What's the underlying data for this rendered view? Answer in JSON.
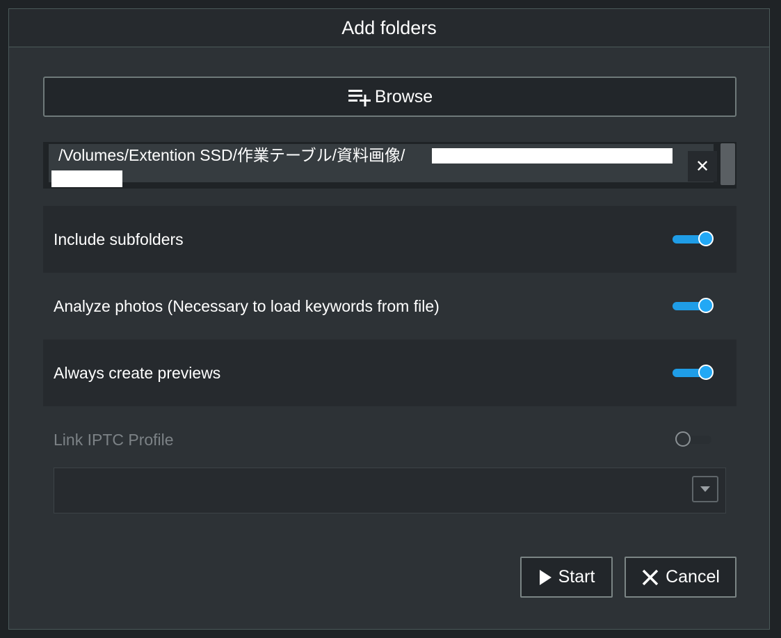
{
  "dialog": {
    "title": "Add folders"
  },
  "browse": {
    "label": "Browse",
    "icon": "playlist-add-icon"
  },
  "folders": [
    {
      "path": "/Volumes/Extention SSD/作業テーブル/資料画像/",
      "remove_icon": "close-icon",
      "remove_symbol": "✕"
    }
  ],
  "options": [
    {
      "label": "Include subfolders",
      "enabled": true,
      "disabled": false
    },
    {
      "label": "Analyze photos (Necessary to load keywords from file)",
      "enabled": true,
      "disabled": false
    },
    {
      "label": "Always create previews",
      "enabled": true,
      "disabled": false
    },
    {
      "label": "Link IPTC Profile",
      "enabled": false,
      "disabled": true
    }
  ],
  "iptc_select": {
    "value": "",
    "icon": "caret-down-icon"
  },
  "actions": {
    "start_label": "Start",
    "start_icon": "play-icon",
    "cancel_label": "Cancel",
    "cancel_icon": "close-icon"
  },
  "colors": {
    "accent": "#1f9de7",
    "background": "#2d3236",
    "border": "#4b5a5a"
  }
}
